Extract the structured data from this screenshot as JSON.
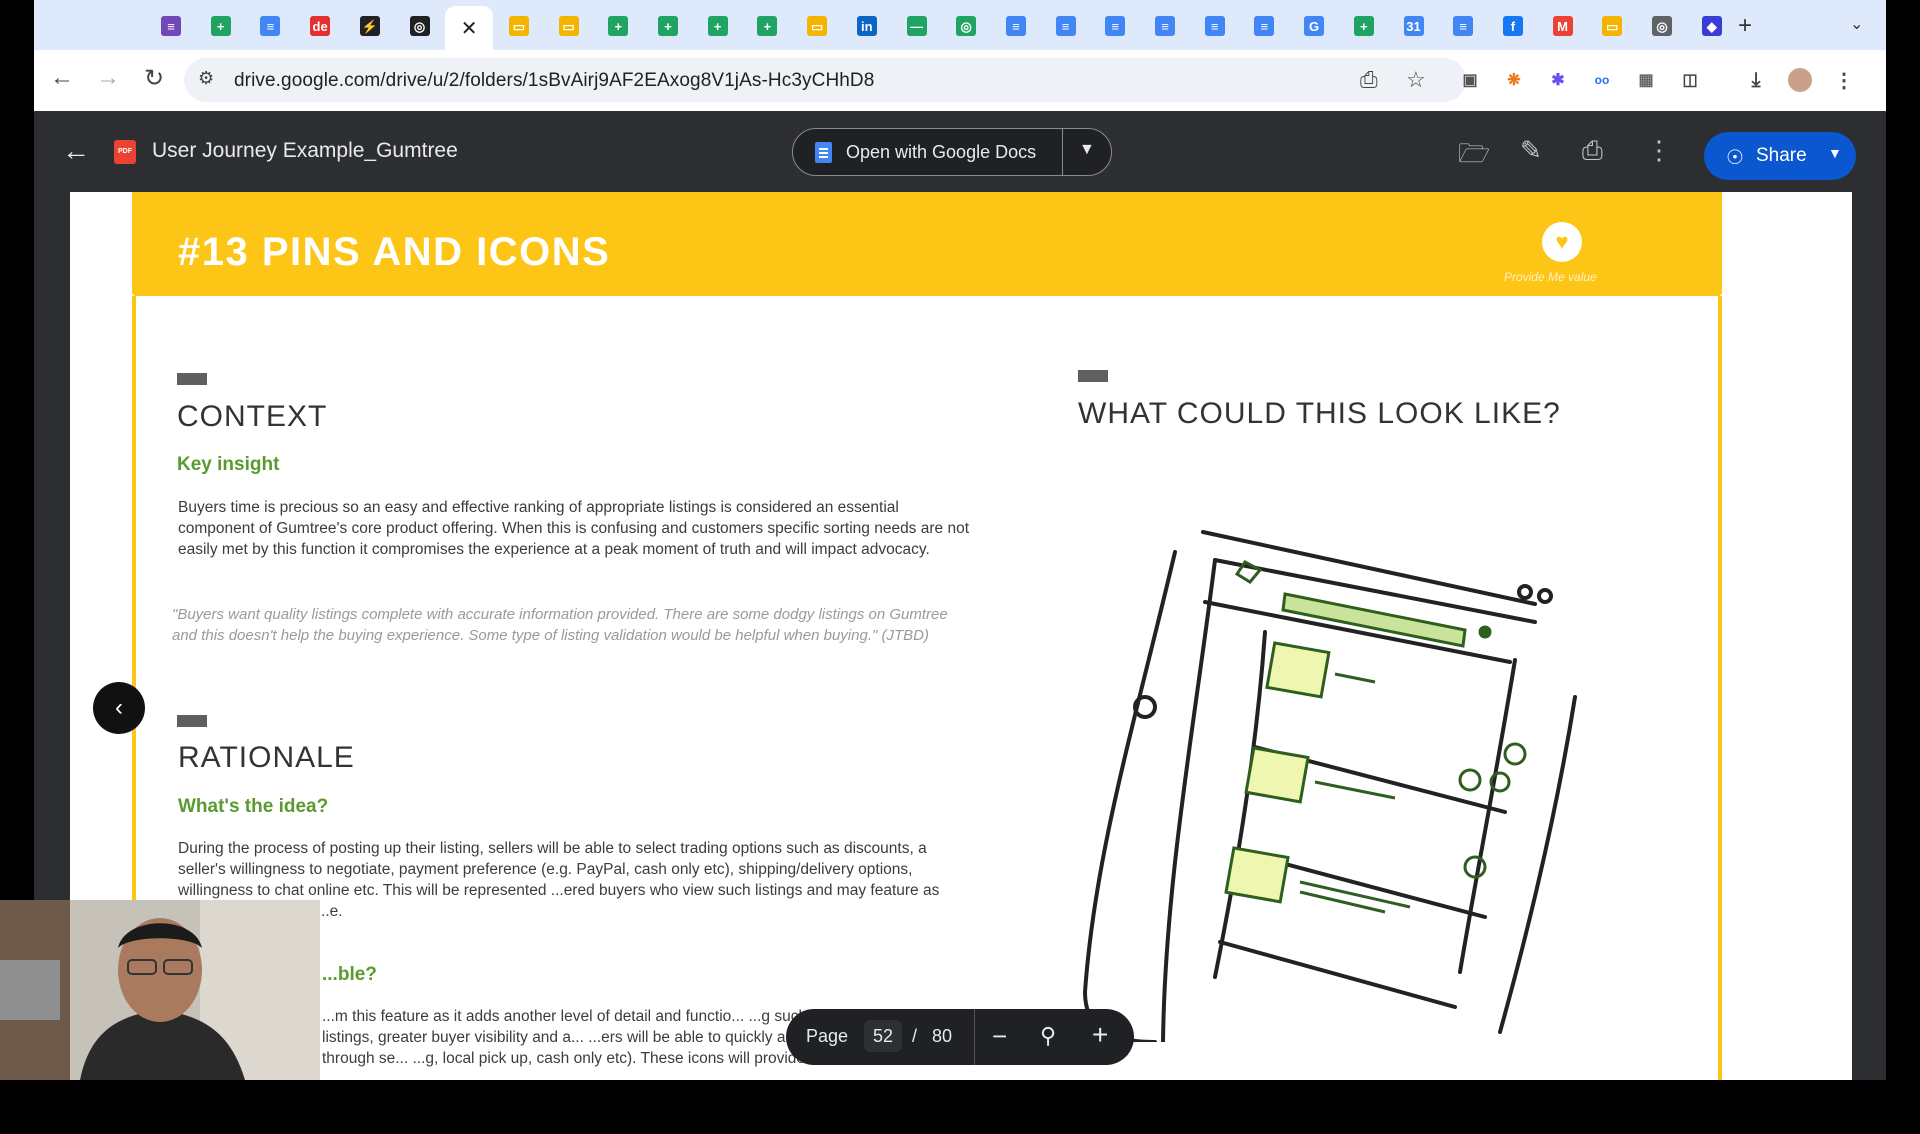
{
  "browser": {
    "tabs": [
      {
        "icon": "forms-icon",
        "color": "#7248b9"
      },
      {
        "icon": "sheets-icon",
        "color": "#1fa463"
      },
      {
        "icon": "docs-icon",
        "color": "#4285f4"
      },
      {
        "icon": "dext-icon",
        "color": "#e4312f"
      },
      {
        "icon": "bolt-icon",
        "color": "#202124"
      },
      {
        "icon": "app-icon",
        "color": "#202124"
      },
      {
        "icon": "close-icon",
        "color": "#202124"
      },
      {
        "icon": "slides-icon",
        "color": "#f4b400"
      },
      {
        "icon": "slides-icon",
        "color": "#f4b400"
      },
      {
        "icon": "sheets-icon",
        "color": "#1fa463"
      },
      {
        "icon": "sheets-icon",
        "color": "#1fa463"
      },
      {
        "icon": "sheets-icon",
        "color": "#1fa463"
      },
      {
        "icon": "sheets-icon",
        "color": "#1fa463"
      },
      {
        "icon": "slides-icon",
        "color": "#f4b400"
      },
      {
        "icon": "linkedin-icon",
        "color": "#0a66c2"
      },
      {
        "icon": "leaf-icon",
        "color": "#1fa463"
      },
      {
        "icon": "app-icon",
        "color": "#1fa463"
      },
      {
        "icon": "docs-icon",
        "color": "#4285f4"
      },
      {
        "icon": "docs-icon",
        "color": "#4285f4"
      },
      {
        "icon": "docs-icon",
        "color": "#4285f4"
      },
      {
        "icon": "docs-icon",
        "color": "#4285f4"
      },
      {
        "icon": "docs-icon",
        "color": "#4285f4"
      },
      {
        "icon": "docs-icon",
        "color": "#4285f4"
      },
      {
        "icon": "google-icon",
        "color": "#4285f4"
      },
      {
        "icon": "sheets-icon",
        "color": "#1fa463"
      },
      {
        "icon": "calendar-icon",
        "color": "#4285f4"
      },
      {
        "icon": "docs-icon",
        "color": "#4285f4"
      },
      {
        "icon": "facebook-icon",
        "color": "#1877f2"
      },
      {
        "icon": "gmail-icon",
        "color": "#ea4335"
      },
      {
        "icon": "slides-icon",
        "color": "#f4b400"
      },
      {
        "icon": "globe-icon",
        "color": "#5f6368"
      },
      {
        "icon": "cube-icon",
        "color": "#3b3bd6"
      }
    ],
    "url": "drive.google.com/drive/u/2/folders/1sBvAirj9AF2EAxog8V1jAs-Hc3yCHhD8"
  },
  "viewer": {
    "file_title": "User Journey Example_Gumtree",
    "file_badge": "PDF",
    "open_with_label": "Open with Google Docs",
    "share_label": "Share",
    "page_word": "Page",
    "current_page": "52",
    "page_slash": "/",
    "total_pages": "80"
  },
  "slide": {
    "title": "#13 PINS AND ICONS",
    "brand_tag": "Provide Me value",
    "context_heading": "CONTEXT",
    "key_insight_heading": "Key insight",
    "key_insight_body": "Buyers time is precious so an easy and effective ranking of appropriate listings is considered an essential component of Gumtree's core product offering. When this is confusing and customers specific sorting needs are not easily met by this function it compromises the experience at a peak moment of truth and will impact advocacy.",
    "quote": "\"Buyers want quality listings complete with accurate information provided. There are some dodgy listings on Gumtree and this doesn't help the buying experience. Some type of listing validation would be helpful when buying.\" (JTBD)",
    "rationale_heading": "RATIONALE",
    "idea_heading": "What's the idea?",
    "idea_body": "During the process of posting up their listing, sellers will be able to select trading options such as discounts, a seller's willingness to negotiate, payment preference (e.g. PayPal, cash only etc), shipping/delivery options, willingness to chat online etc. This will be represented ...ered buyers who view such listings and may feature as part of the Gumtree ...e.",
    "valuable_heading": "...ble?",
    "valuable_body": "...m this feature as it adds another level of detail and functio... ...g such icons to their listings, greater buyer visibility and a... ...ers will be able to quickly and conveniently scan through se... ...g, local pick up, cash only etc). These icons will provide Gumtree a sense",
    "look_heading": "WHAT COULD THIS LOOK LIKE?"
  }
}
